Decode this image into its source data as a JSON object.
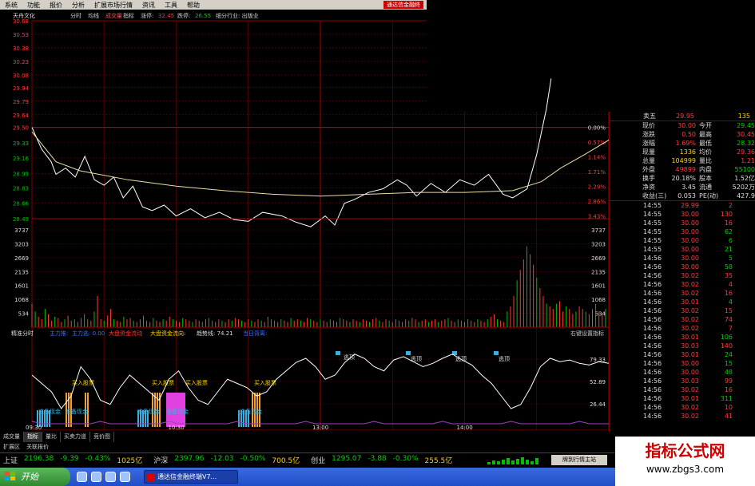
{
  "menu": [
    "系统",
    "功能",
    "报价",
    "分析",
    "扩展市场行情",
    "资讯",
    "工具",
    "帮助"
  ],
  "app_title": "通达信金融终",
  "header": {
    "stock_name": "天舟文化",
    "tabs": [
      "分时",
      "均线",
      "成交量",
      "指标"
    ],
    "limit_up_label": "涨停:",
    "limit_up": "32.45",
    "limit_down_label": "跌停:",
    "limit_down": "26.55",
    "sector": "细分行业: 出版业"
  },
  "price_axis": [
    "30.68",
    "30.53",
    "30.38",
    "30.23",
    "30.08",
    "29.94",
    "29.79",
    "29.64",
    "29.50",
    "29.33",
    "29.16",
    "28.99",
    "28.83",
    "28.66",
    "28.49"
  ],
  "pct_axis": [
    "0.00%",
    "0.57%",
    "1.14%",
    "1.71%",
    "2.29%",
    "2.86%",
    "3.43%"
  ],
  "volume_axis": [
    "3737",
    "3203",
    "2669",
    "2135",
    "1601",
    "1068",
    "534"
  ],
  "volume_axis_right": [
    "3737",
    "3203",
    "2669",
    "2135",
    "1601",
    "1068",
    "534"
  ],
  "indicator_header": {
    "name": "精准分时",
    "items": [
      "主力推:",
      "主力逃: 0.00",
      "大盘资金流动",
      "大盘资金流向:",
      "趋势线: 74.21",
      "当日背离:"
    ],
    "right": "右键设置指标"
  },
  "indicator_axis": [
    "79.33",
    "52.89",
    "26.44"
  ],
  "indicator_labels": {
    "buy": "买入股票",
    "reduce": "准备现金",
    "sell": "逃顶"
  },
  "time_axis": [
    "09:30",
    "10:30",
    "13:00",
    "14:00"
  ],
  "quote": {
    "sell5_label": "卖五",
    "sell5_price": "29.95",
    "sell5_vol": "135",
    "stats": [
      {
        "a": "现价",
        "b": "30.00",
        "bc": "red",
        "c": "今开",
        "d": "29.45",
        "dc": "green"
      },
      {
        "a": "涨跌",
        "b": "0.50",
        "bc": "red",
        "c": "最高",
        "d": "30.45",
        "dc": "red"
      },
      {
        "a": "涨幅",
        "b": "1.69%",
        "bc": "red",
        "c": "最低",
        "d": "28.32",
        "dc": "green"
      },
      {
        "a": "现量",
        "b": "1336",
        "bc": "yellow",
        "c": "均价",
        "d": "29.36",
        "dc": "red"
      },
      {
        "a": "总量",
        "b": "104999",
        "bc": "yellow",
        "c": "量比",
        "d": "1.21",
        "dc": "red"
      },
      {
        "a": "外盘",
        "b": "49899",
        "bc": "red",
        "c": "内盘",
        "d": "55100",
        "dc": "green"
      },
      {
        "a": "换手",
        "b": "20.18%",
        "bc": "white",
        "c": "股本",
        "d": "1.52亿",
        "dc": "white"
      },
      {
        "a": "净资",
        "b": "3.45",
        "bc": "white",
        "c": "流通",
        "d": "5202万",
        "dc": "white"
      },
      {
        "a": "收益(三)",
        "b": "0.053",
        "bc": "white",
        "c": "PE(动)",
        "d": "427.9",
        "dc": "white"
      }
    ],
    "ticks": [
      {
        "t": "14:55",
        "p": "29.99",
        "v": "2",
        "vc": "red"
      },
      {
        "t": "14:55",
        "p": "30.00",
        "v": "130",
        "vc": "red"
      },
      {
        "t": "14:55",
        "p": "30.00",
        "v": "16",
        "vc": "red"
      },
      {
        "t": "14:55",
        "p": "30.00",
        "v": "62",
        "vc": "green"
      },
      {
        "t": "14:55",
        "p": "30.00",
        "v": "6",
        "vc": "green"
      },
      {
        "t": "14:55",
        "p": "30.00",
        "v": "21",
        "vc": "green"
      },
      {
        "t": "14:56",
        "p": "30.00",
        "v": "5",
        "vc": "green"
      },
      {
        "t": "14:56",
        "p": "30.00",
        "v": "58",
        "vc": "green"
      },
      {
        "t": "14:56",
        "p": "30.02",
        "v": "35",
        "vc": "red"
      },
      {
        "t": "14:56",
        "p": "30.02",
        "v": "4",
        "vc": "red"
      },
      {
        "t": "14:56",
        "p": "30.02",
        "v": "16",
        "vc": "red"
      },
      {
        "t": "14:56",
        "p": "30.01",
        "v": "4",
        "vc": "green"
      },
      {
        "t": "14:56",
        "p": "30.02",
        "v": "15",
        "vc": "red"
      },
      {
        "t": "14:56",
        "p": "30.02",
        "v": "74",
        "vc": "red"
      },
      {
        "t": "14:56",
        "p": "30.02",
        "v": "7",
        "vc": "red"
      },
      {
        "t": "14:56",
        "p": "30.01",
        "v": "106",
        "vc": "green"
      },
      {
        "t": "14:56",
        "p": "30.03",
        "v": "140",
        "vc": "red"
      },
      {
        "t": "14:56",
        "p": "30.01",
        "v": "24",
        "vc": "green"
      },
      {
        "t": "14:56",
        "p": "30.00",
        "v": "15",
        "vc": "green"
      },
      {
        "t": "14:56",
        "p": "30.00",
        "v": "48",
        "vc": "green"
      },
      {
        "t": "14:56",
        "p": "30.03",
        "v": "99",
        "vc": "red"
      },
      {
        "t": "14:56",
        "p": "30.02",
        "v": "16",
        "vc": "red"
      },
      {
        "t": "14:56",
        "p": "30.01",
        "v": "311",
        "vc": "green"
      },
      {
        "t": "14:56",
        "p": "30.02",
        "v": "10",
        "vc": "red"
      },
      {
        "t": "14:56",
        "p": "30.02",
        "v": "41",
        "vc": "red"
      }
    ]
  },
  "bottom_tabs": [
    "成交量",
    "指标",
    "量比",
    "买卖力道",
    "竞价图"
  ],
  "sub_tabs": [
    "扩展区",
    "关联报价"
  ],
  "ticker": [
    {
      "name": "上证",
      "value": "2196.38",
      "chg": "-9.39",
      "pct": "-0.43%",
      "amt": "1025亿"
    },
    {
      "name": "沪深",
      "value": "2397.96",
      "chg": "-12.03",
      "pct": "-0.50%",
      "amt": "700.5亿"
    },
    {
      "name": "创业",
      "value": "1295.07",
      "chg": "-3.88",
      "pct": "-0.30%",
      "amt": "255.5亿"
    }
  ],
  "ticker_button": "牌到行情主站",
  "taskbar": {
    "start": "开始",
    "task": "通达信金融终端V7..."
  },
  "watermark": {
    "title": "指标公式网",
    "url": "www.zbgs3.com"
  },
  "chart_data": {
    "type": "line",
    "price_range": [
      28.32,
      30.68
    ],
    "price_line": [
      {
        "t": 0,
        "p": 29.5
      },
      {
        "t": 4,
        "p": 29.26
      },
      {
        "t": 8,
        "p": 29.12
      },
      {
        "t": 10,
        "p": 28.98
      },
      {
        "t": 14,
        "p": 29.05
      },
      {
        "t": 18,
        "p": 28.95
      },
      {
        "t": 22,
        "p": 29.18
      },
      {
        "t": 26,
        "p": 28.92
      },
      {
        "t": 30,
        "p": 28.86
      },
      {
        "t": 34,
        "p": 28.95
      },
      {
        "t": 38,
        "p": 28.72
      },
      {
        "t": 42,
        "p": 28.85
      },
      {
        "t": 46,
        "p": 28.62
      },
      {
        "t": 50,
        "p": 28.58
      },
      {
        "t": 55,
        "p": 28.64
      },
      {
        "t": 60,
        "p": 28.52
      },
      {
        "t": 66,
        "p": 28.6
      },
      {
        "t": 72,
        "p": 28.5
      },
      {
        "t": 78,
        "p": 28.56
      },
      {
        "t": 84,
        "p": 28.48
      },
      {
        "t": 90,
        "p": 28.46
      },
      {
        "t": 96,
        "p": 28.56
      },
      {
        "t": 104,
        "p": 28.52
      },
      {
        "t": 110,
        "p": 28.45
      },
      {
        "t": 116,
        "p": 28.4
      },
      {
        "t": 122,
        "p": 28.52
      },
      {
        "t": 126,
        "p": 28.42
      },
      {
        "t": 130,
        "p": 28.66
      },
      {
        "t": 134,
        "p": 28.7
      },
      {
        "t": 140,
        "p": 28.78
      },
      {
        "t": 146,
        "p": 28.82
      },
      {
        "t": 152,
        "p": 28.92
      },
      {
        "t": 156,
        "p": 28.86
      },
      {
        "t": 160,
        "p": 28.74
      },
      {
        "t": 166,
        "p": 28.88
      },
      {
        "t": 172,
        "p": 28.78
      },
      {
        "t": 178,
        "p": 28.92
      },
      {
        "t": 184,
        "p": 28.86
      },
      {
        "t": 190,
        "p": 28.98
      },
      {
        "t": 196,
        "p": 28.76
      },
      {
        "t": 200,
        "p": 28.72
      },
      {
        "t": 206,
        "p": 28.82
      },
      {
        "t": 210,
        "p": 29.2
      },
      {
        "t": 214,
        "p": 29.7
      },
      {
        "t": 216,
        "p": 30.04
      }
    ],
    "avg_line": [
      {
        "t": 0,
        "p": 29.45
      },
      {
        "t": 10,
        "p": 29.12
      },
      {
        "t": 20,
        "p": 29.02
      },
      {
        "t": 40,
        "p": 28.92
      },
      {
        "t": 60,
        "p": 28.85
      },
      {
        "t": 80,
        "p": 28.8
      },
      {
        "t": 100,
        "p": 28.76
      },
      {
        "t": 120,
        "p": 28.74
      },
      {
        "t": 140,
        "p": 28.76
      },
      {
        "t": 160,
        "p": 28.78
      },
      {
        "t": 180,
        "p": 28.78
      },
      {
        "t": 200,
        "p": 28.8
      },
      {
        "t": 212,
        "p": 28.9
      },
      {
        "t": 220,
        "p": 29.05
      },
      {
        "t": 230,
        "p": 29.2
      },
      {
        "t": 240,
        "p": 29.36
      }
    ],
    "volume_max": 3737,
    "volumes": [
      900,
      600,
      400,
      300,
      700,
      500,
      250,
      400,
      350,
      200,
      300,
      450,
      250,
      300,
      200,
      350,
      500,
      300,
      250,
      600,
      1200,
      300,
      250,
      450,
      700,
      300,
      250,
      200,
      400,
      300,
      350,
      250,
      200,
      300,
      450,
      250,
      200,
      350,
      250,
      200,
      300,
      250,
      400,
      300,
      250,
      200,
      350,
      300,
      250,
      200,
      300,
      250,
      200,
      300,
      350,
      250,
      200,
      300,
      250,
      200,
      300,
      250,
      350,
      300,
      250,
      200,
      300,
      250,
      200,
      300,
      250,
      200,
      400,
      300,
      250,
      200,
      300,
      250,
      200,
      350,
      250,
      300,
      250,
      200,
      350,
      300,
      250,
      200,
      300,
      250,
      200,
      300,
      250,
      200,
      350,
      300,
      250,
      200,
      300,
      250,
      200,
      300,
      250,
      200,
      300,
      350,
      250,
      200,
      300,
      250,
      200,
      300,
      250,
      200,
      300,
      250,
      350,
      300,
      200,
      250,
      300,
      200,
      250,
      300,
      200,
      250,
      300,
      350,
      250,
      200,
      300,
      250,
      200,
      300,
      250,
      200,
      300,
      250,
      200,
      300,
      400,
      500,
      300,
      250,
      200,
      600,
      800,
      1200,
      1800,
      2200,
      2600,
      3100,
      2800,
      2400,
      1900,
      1500,
      1200,
      900,
      800,
      700,
      900,
      1000,
      600,
      800,
      700,
      500,
      600,
      800,
      700,
      600,
      500,
      700,
      900,
      600,
      500,
      700
    ],
    "indicator_line": [
      60,
      50,
      40,
      20,
      35,
      70,
      55,
      30,
      25,
      45,
      60,
      50,
      40,
      30,
      55,
      65,
      45,
      30,
      25,
      40,
      55,
      50,
      45,
      35,
      40,
      55,
      65,
      75,
      80,
      70,
      55,
      60,
      75,
      85,
      80,
      70,
      65,
      78,
      82,
      76,
      70,
      74,
      80,
      85,
      78,
      72,
      60,
      50,
      35,
      20,
      25,
      45,
      70,
      80,
      76,
      78,
      74,
      72,
      76,
      74
    ]
  }
}
